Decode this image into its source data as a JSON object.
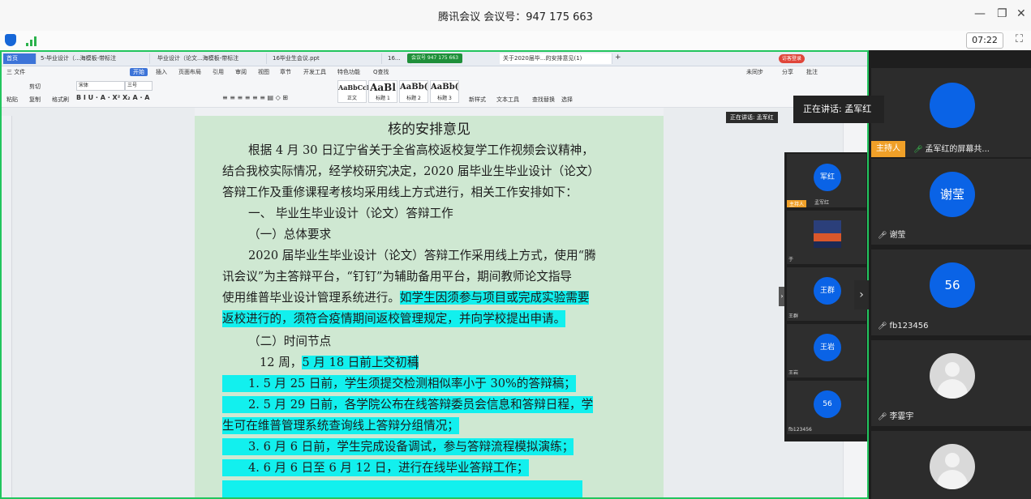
{
  "window": {
    "title": "腾讯会议 会议号：947 175 663",
    "timer": "07:22"
  },
  "wps": {
    "tabs": [
      "首页",
      "5-毕业设计（...海模板-带标注",
      "毕业设计（论文...海模板-带标注",
      "16毕业生会议.ppt",
      "16...",
      "关于2020届毕...的安排意见(1)"
    ],
    "share_badge": "会议号 947 175 663",
    "login": "访客登录",
    "menus": [
      "三 文件",
      "开始",
      "插入",
      "页面布局",
      "引用",
      "审阅",
      "视图",
      "章节",
      "开发工具",
      "特色功能",
      "Q查找"
    ],
    "right_menus": [
      "未同步",
      "分享",
      "批注"
    ],
    "ribbon": {
      "paste": "粘贴",
      "cut": "剪切",
      "copy": "复制",
      "format_painter": "格式刷",
      "font": "宋体",
      "size": "三号",
      "styles": [
        {
          "sample": "AaBbCcD",
          "name": "正文"
        },
        {
          "sample": "AaBl",
          "name": "标题 1"
        },
        {
          "sample": "AaBb(",
          "name": "标题 2"
        },
        {
          "sample": "AaBb(",
          "name": "标题 3"
        }
      ],
      "new_style": "新样式",
      "text_tools": "文本工具",
      "find_replace": "查找替换",
      "select": "选择"
    }
  },
  "document": {
    "title": "核的安排意见",
    "lines": [
      "根据 4 月 30 日辽宁省关于全省高校返校复学工作视频会议精神，",
      "结合我校实际情况，经学校研究决定，2020 届毕业生毕业设计（论文）",
      "答辩工作及重修课程考核均采用线上方式进行，相关工作安排如下：",
      "一、 毕业生毕业设计（论文）答辩工作",
      "（一）总体要求",
      "2020 届毕业生毕业设计（论文）答辩工作采用线上方式，使用“腾",
      "讯会议”为主答辩平台，“钉钉”为辅助备用平台，期间教师论文指导",
      "使用维普毕业设计管理系统进行。",
      "如学生因须参与项目或完成实验需要",
      "返校进行的，须符合疫情期间返校管理规定，并向学校提出申请。",
      "（二）时间节点",
      "12 周，",
      "5 月 18 日前上交初稿",
      "1. 5 月 25 日前，学生须提交检测相似率小于 30%的答辩稿；",
      "2. 5 月 29 日前，各学院公布在线答辩委员会信息和答辩日程，学",
      "生可在维普管理系统查询线上答辩分组情况；",
      "3. 6 月 6 日前，学生完成设备调试，参与答辩流程模拟演练；",
      "4. 6 月 6 日至 6 月 12 日，进行在线毕业答辩工作；"
    ]
  },
  "speaking": {
    "small": "正在讲话: 孟军红",
    "big": "正在讲话: 孟军红"
  },
  "mini_panel": {
    "tiles": [
      {
        "avatar": "军红",
        "name": "孟军红",
        "host": "主持人"
      },
      {
        "avatar": "",
        "name": "于"
      },
      {
        "avatar": "王群",
        "name": "王群"
      },
      {
        "avatar": "王岩",
        "name": "王岩"
      },
      {
        "avatar": "56",
        "name": "fb123456"
      }
    ]
  },
  "panel": {
    "host_label": "主持人",
    "host_name": "孟军红的屏幕共...",
    "participants": [
      {
        "avatar": "谢莹",
        "name": "谢莹"
      },
      {
        "avatar": "56",
        "name": "fb123456"
      },
      {
        "avatar": "",
        "name": "李霎宇"
      },
      {
        "avatar": "",
        "name": ""
      }
    ]
  },
  "colors": {
    "highlight": "#12f0ee",
    "page_bg": "#cfe8d2",
    "share_border": "#22c55e",
    "avatar_blue": "#0a63e6",
    "host_orange": "#f0a028"
  }
}
